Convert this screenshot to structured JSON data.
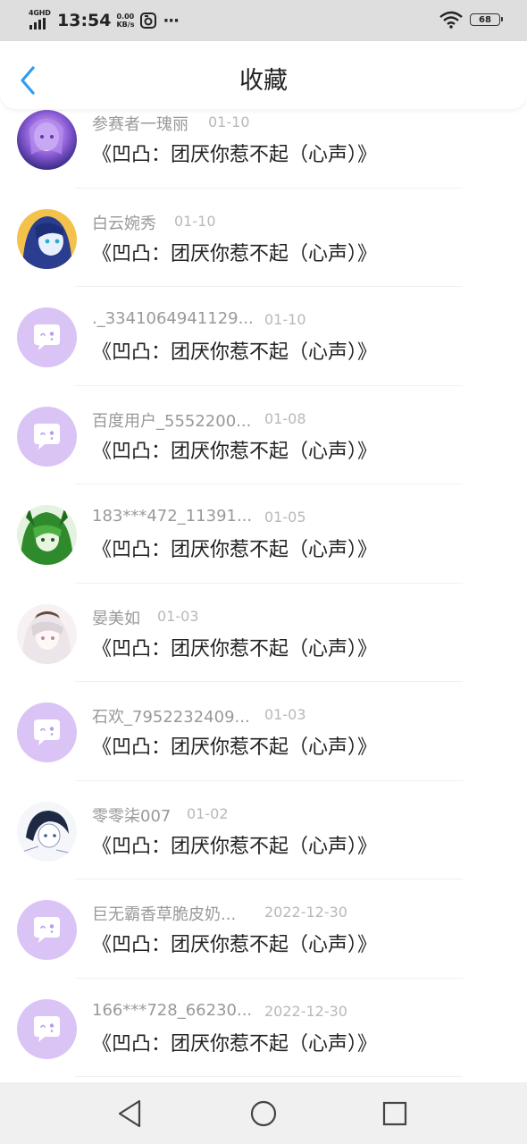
{
  "status_bar": {
    "network": "4GHD",
    "time": "13:54",
    "speed_value": "0.00",
    "speed_unit": "KB/s",
    "more": "···",
    "battery": "68"
  },
  "header": {
    "title": "收藏"
  },
  "items": [
    {
      "user": "参赛者一瑰丽",
      "date": "01-10",
      "title": "《凹凸：团厌你惹不起（心声）》",
      "avatar": "anime-purple"
    },
    {
      "user": "白云婉秀",
      "date": "01-10",
      "title": "《凹凸：团厌你惹不起（心声）》",
      "avatar": "anime-blue-hair"
    },
    {
      "user": "._3341064941129...",
      "date": "01-10",
      "title": "《凹凸：团厌你惹不起（心声）》",
      "avatar": "default-chat"
    },
    {
      "user": "百度用户_5552200...",
      "date": "01-08",
      "title": "《凹凸：团厌你惹不起（心声）》",
      "avatar": "default-chat"
    },
    {
      "user": "183***472_11391...",
      "date": "01-05",
      "title": "《凹凸：团厌你惹不起（心声）》",
      "avatar": "anime-green"
    },
    {
      "user": "晏美如",
      "date": "01-03",
      "title": "《凹凸：团厌你惹不起（心声）》",
      "avatar": "anime-white-hair"
    },
    {
      "user": "石欢_7952232409...",
      "date": "01-03",
      "title": "《凹凸：团厌你惹不起（心声）》",
      "avatar": "default-chat"
    },
    {
      "user": "零零柒007",
      "date": "01-02",
      "title": "《凹凸：团厌你惹不起（心声）》",
      "avatar": "anime-sketch"
    },
    {
      "user": "巨无霸香草脆皮奶...",
      "date": "2022-12-30",
      "title": "《凹凸：团厌你惹不起（心声）》",
      "avatar": "default-chat"
    },
    {
      "user": "166***728_66230...",
      "date": "2022-12-30",
      "title": "《凹凸：团厌你惹不起（心声）》",
      "avatar": "default-chat"
    },
    {
      "user": "",
      "date": "",
      "title": "",
      "avatar": "none"
    }
  ],
  "colors": {
    "accent": "#2e9df0",
    "default_avatar": "#d9c4f5",
    "username": "#999999",
    "date": "#b8b8b8",
    "title": "#222222"
  }
}
